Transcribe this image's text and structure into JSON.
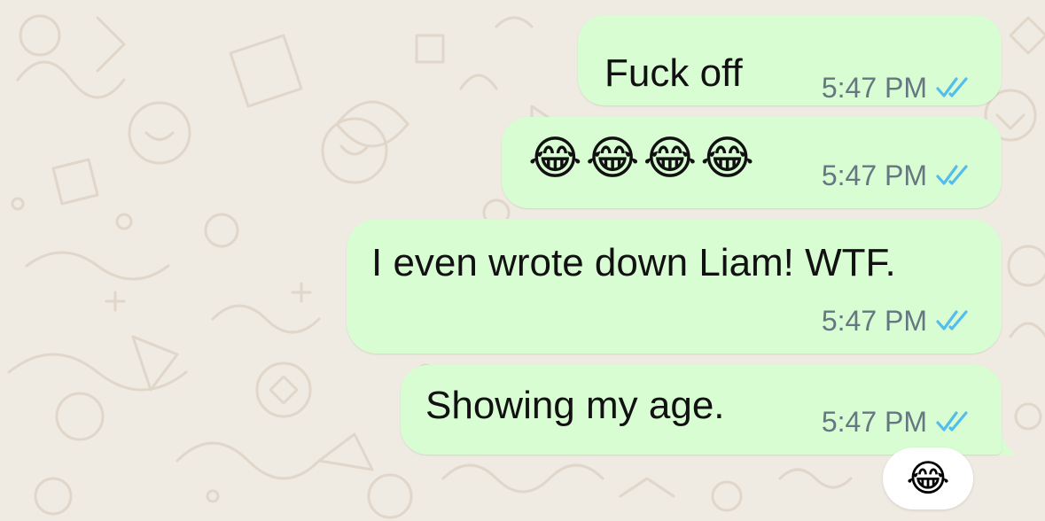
{
  "colors": {
    "wallpaper": "#efeae2",
    "outgoing_bubble": "#d9fdd3",
    "message_text": "#111111",
    "timestamp": "#667781",
    "read_ticks": "#53bdeb",
    "reaction_bg": "#ffffff"
  },
  "messages": [
    {
      "text": "Fuck off",
      "time": "5:47 PM",
      "status_icon": "double-check-read-icon"
    },
    {
      "text": "😂😂😂😂",
      "time": "5:47 PM",
      "status_icon": "double-check-read-icon"
    },
    {
      "text": "I even wrote down Liam! WTF.",
      "time": "5:47 PM",
      "status_icon": "double-check-read-icon"
    },
    {
      "text": "Showing my age.",
      "time": "5:47 PM",
      "status_icon": "double-check-read-icon"
    }
  ],
  "reaction": {
    "emoji": "😂"
  }
}
